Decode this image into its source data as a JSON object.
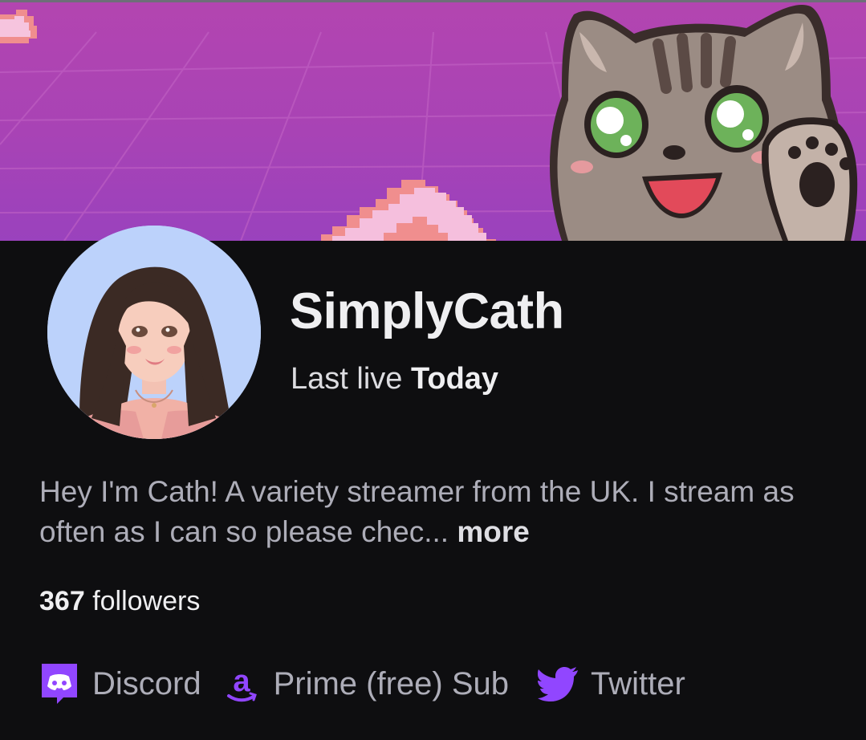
{
  "channel": {
    "name": "SimplyCath",
    "last_live_prefix": "Last live",
    "last_live_value": "Today"
  },
  "bio": {
    "text": "Hey I'm Cath! A variety streamer from the UK. I stream as often as I can so please chec...",
    "more_label": "more"
  },
  "followers": {
    "count": "367",
    "label": "followers"
  },
  "links": [
    {
      "label": "Discord",
      "icon": "discord-icon"
    },
    {
      "label": "Prime (free) Sub",
      "icon": "amazon-icon"
    },
    {
      "label": "Twitter",
      "icon": "twitter-icon"
    }
  ],
  "colors": {
    "background": "#0e0e10",
    "banner": "#b345b0",
    "accent": "#9146ff",
    "avatar_bg": "#bcd2fb"
  }
}
